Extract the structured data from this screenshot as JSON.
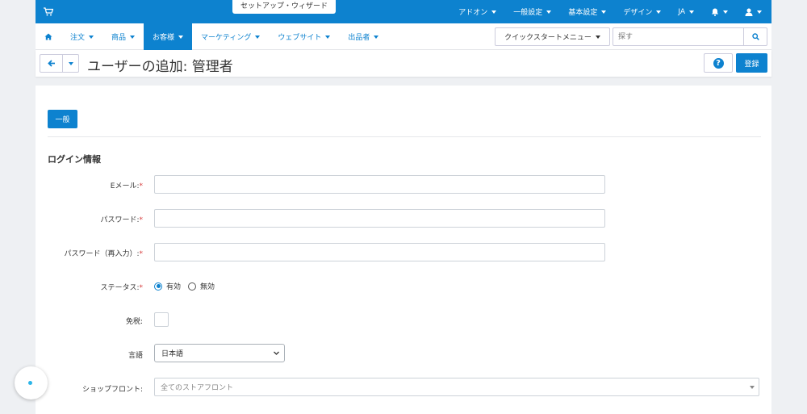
{
  "topbar": {
    "wizard_label": "セットアップ・ウィザード",
    "menu": [
      {
        "label": "アドオン"
      },
      {
        "label": "一般設定"
      },
      {
        "label": "基本設定"
      },
      {
        "label": "デザイン"
      },
      {
        "label": "JA"
      }
    ]
  },
  "nav": {
    "items": [
      {
        "label": "注文"
      },
      {
        "label": "商品"
      },
      {
        "label": "お客様"
      },
      {
        "label": "マーケティング"
      },
      {
        "label": "ウェブサイト"
      },
      {
        "label": "出品者"
      }
    ],
    "quick_start_label": "クイックスタートメニュー",
    "search_placeholder": "探す"
  },
  "header": {
    "title": "ユーザーの追加: 管理者",
    "save_label": "登録",
    "help_label": "?"
  },
  "form": {
    "tab_general": "一般",
    "section_title": "ログイン情報",
    "email_label": "Eメール:",
    "password_label": "パスワード:",
    "password_confirm_label": "パスワード（再入力）:",
    "status_label": "ステータス:",
    "status_active": "有効",
    "status_disabled": "無効",
    "tax_exempt_label": "免税:",
    "language_label": "言語",
    "language_value": "日本語",
    "storefront_label": "ショップフロント:",
    "storefront_placeholder": "全てのストアフロント",
    "required_mark": "*"
  },
  "colors": {
    "accent": "#0d82cf",
    "required": "#d63b3b"
  }
}
